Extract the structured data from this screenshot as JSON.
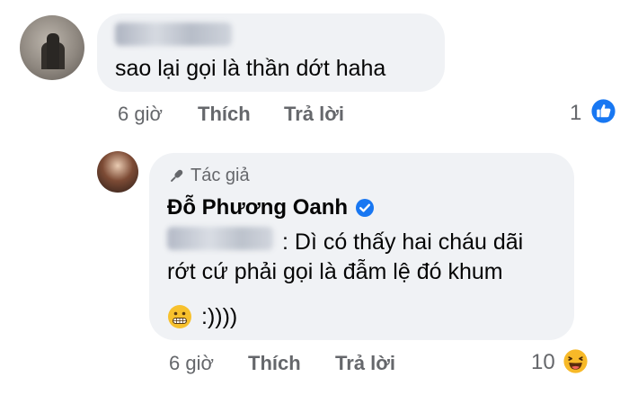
{
  "comment1": {
    "text": "sao lại gọi là thần dớt haha",
    "time": "6 giờ",
    "like": "Thích",
    "reply": "Trả lời",
    "reactions": "1",
    "reaction_icon": "like-icon"
  },
  "comment2": {
    "badge": "Tác giả",
    "author": "Đỗ Phương Oanh",
    "line1": ": Dì có thấy hai cháu dãi",
    "line2": "rớt cứ phải gọi là đẫm lệ đó khum",
    "line3": ":))))",
    "emoji": "grimacing-face",
    "time": "6 giờ",
    "like": "Thích",
    "reply": "Trả lời",
    "reactions": "10",
    "reaction_icon": "haha-icon"
  },
  "colors": {
    "bubble": "#f0f2f5",
    "meta_text": "#65676b",
    "like_blue": "#1877f2",
    "haha_yellow": "#f7b928"
  }
}
